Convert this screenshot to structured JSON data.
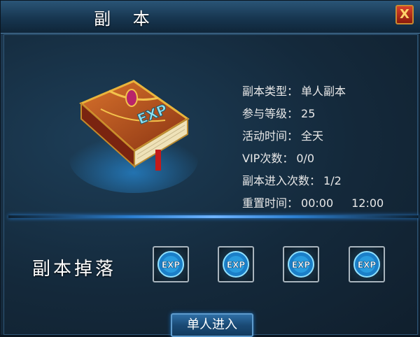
{
  "window": {
    "title": "副 本",
    "close_label": "X"
  },
  "info": [
    {
      "key": "副本类型：",
      "value": "单人副本"
    },
    {
      "key": "参与等级：",
      "value": "25"
    },
    {
      "key": "活动时间：",
      "value": "全天"
    },
    {
      "key": "VIP次数：",
      "value": "0/0"
    },
    {
      "key": "副本进入次数：",
      "value": "1/2"
    },
    {
      "key": "重置时间：",
      "value": "00:00",
      "value2": "12:00"
    }
  ],
  "drops": {
    "label": "副本掉落",
    "items": [
      {
        "icon": "exp-orb-icon",
        "text": "EXP"
      },
      {
        "icon": "exp-orb-icon",
        "text": "EXP"
      },
      {
        "icon": "exp-orb-icon",
        "text": "EXP"
      },
      {
        "icon": "exp-orb-icon",
        "text": "EXP"
      }
    ]
  },
  "book": {
    "icon": "exp-book-icon",
    "text": "EXP"
  },
  "enter_button": {
    "label": "单人进入"
  },
  "colors": {
    "accent": "#2c7fd0",
    "title_text": "#ffffff",
    "info_text": "#e8e8e8",
    "close_button": "#c0301c"
  }
}
